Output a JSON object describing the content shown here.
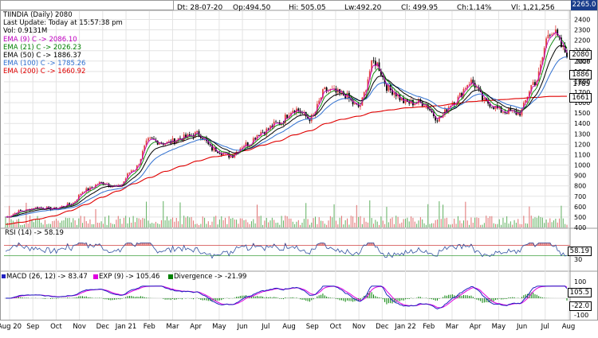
{
  "header": {
    "dt": "Dt: 28-07-20",
    "op": "Op:494.50",
    "hi": "Hi: 505.05",
    "lw": "Lw:492.20",
    "cl": "Cl: 499.95",
    "ch": "Ch:1.14%",
    "vl": "Vl: 1,21,256"
  },
  "last_price": "2265.0",
  "info": {
    "title": "TIINDIA (Daily) 2080",
    "update": "Last Update: Today at 15:57:38 pm",
    "vol": "Vol: 0.9131M",
    "ema9": "EMA (9) C -> 2086.10",
    "ema21": "EMA (21) C -> 2026.23",
    "ema50": "EMA (50) C -> 1886.37",
    "ema100": "EMA (100) C -> 1785.26",
    "ema200": "EMA (200) C -> 1660.92"
  },
  "price_boxes": {
    "b2080": "2080",
    "b2026": "2026",
    "b1886": "1886",
    "b1785": "1785",
    "b1661": "1661"
  },
  "rsi": {
    "label": "RSI (14) -> 58.19",
    "box": "58.19",
    "level": "30"
  },
  "macd": {
    "macd_label": "MACD (26, 12) -> 83.47",
    "exp_label": "EXP (9) -> 105.46",
    "div_label": "Divergence -> -21.99",
    "box1": "105.5",
    "box2": "-22.0",
    "tick_top": "100",
    "tick_bottom": "-100"
  },
  "colors": {
    "ema9": "#c000c0",
    "ema21": "#008000",
    "ema50": "#000000",
    "ema100": "#3070d0",
    "ema200": "#e00000",
    "up": "#e04040",
    "down": "#000000",
    "rsi": "#3050a0",
    "macd": "#2020c0",
    "exp": "#e000e0",
    "divergence": "#008000"
  },
  "chart_data": {
    "type": "line",
    "title": "TIINDIA (Daily) 2080",
    "x_ticks": [
      "Aug 20",
      "Sep",
      "Oct",
      "Nov",
      "Dec",
      "Jan 21",
      "Feb",
      "Mar",
      "Apr",
      "May",
      "Jun",
      "Jul",
      "Aug",
      "Sep",
      "Oct",
      "Nov",
      "Dec",
      "Jan 22",
      "Feb",
      "Mar",
      "Apr",
      "May",
      "Jun",
      "Jul",
      "Aug"
    ],
    "y_ticks": [
      400,
      500,
      600,
      700,
      800,
      900,
      1000,
      1100,
      1200,
      1300,
      1400,
      1500,
      1600,
      1700,
      1800,
      1900,
      2000,
      2100,
      2200,
      2300,
      2400
    ],
    "ylim": [
      400,
      2480
    ],
    "series": [
      {
        "name": "TIINDIA (Daily) 2080",
        "values": [
          500,
          560,
          590,
          580,
          620,
          760,
          830,
          790,
          960,
          1240,
          1210,
          1260,
          1300,
          1150,
          1090,
          1200,
          1320,
          1400,
          1540,
          1450,
          1720,
          1680,
          1560,
          1990,
          1720,
          1600,
          1600,
          1450,
          1620,
          1800,
          1600,
          1520,
          1500,
          1800,
          2300,
          2080
        ]
      },
      {
        "name": "EMA (200) C -> 1660.92",
        "values": [
          430,
          450,
          480,
          510,
          560,
          620,
          690,
          750,
          820,
          880,
          940,
          990,
          1040,
          1080,
          1100,
          1140,
          1190,
          1230,
          1290,
          1330,
          1400,
          1440,
          1470,
          1510,
          1530,
          1550,
          1560,
          1570,
          1590,
          1610,
          1620,
          1630,
          1640,
          1650,
          1660,
          1661
        ]
      }
    ],
    "rsi": {
      "name": "RSI (14) -> 58.19",
      "levels": [
        30,
        70
      ]
    },
    "macd": {
      "names": [
        "MACD (26, 12) -> 83.47",
        "EXP (9) -> 105.46",
        "Divergence -> -21.99"
      ],
      "y_ticks": [
        100,
        -100
      ]
    }
  }
}
